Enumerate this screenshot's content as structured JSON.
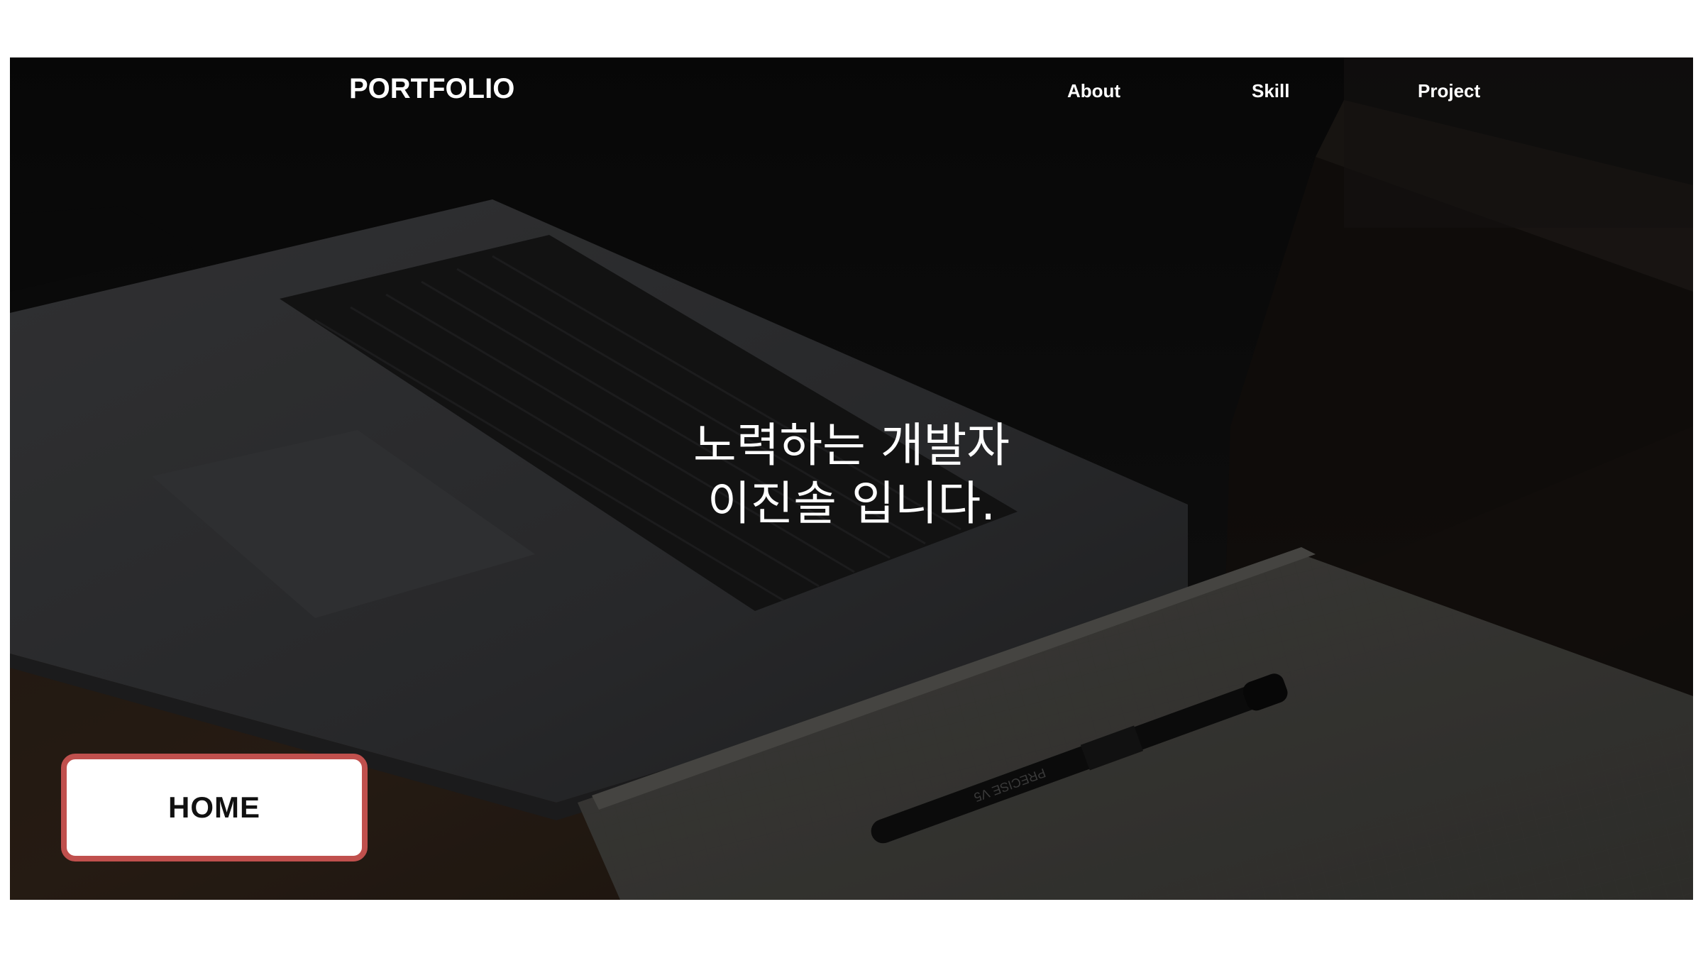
{
  "header": {
    "logo": "PORTFOLIO",
    "nav": [
      {
        "label": "About"
      },
      {
        "label": "Skill"
      },
      {
        "label": "Project"
      }
    ]
  },
  "hero": {
    "line1": "노력하는 개발자",
    "line2": "이진솔 입니다.",
    "overlay_color": "#000000"
  },
  "section_label": {
    "text": "HOME",
    "border_color": "#c0504d"
  },
  "background_scene": {
    "laptop_icon": "laptop-photo",
    "notebook_icon": "notebook-photo",
    "pen_icon": "pen-photo",
    "pen_text": "PRECISE V5"
  }
}
